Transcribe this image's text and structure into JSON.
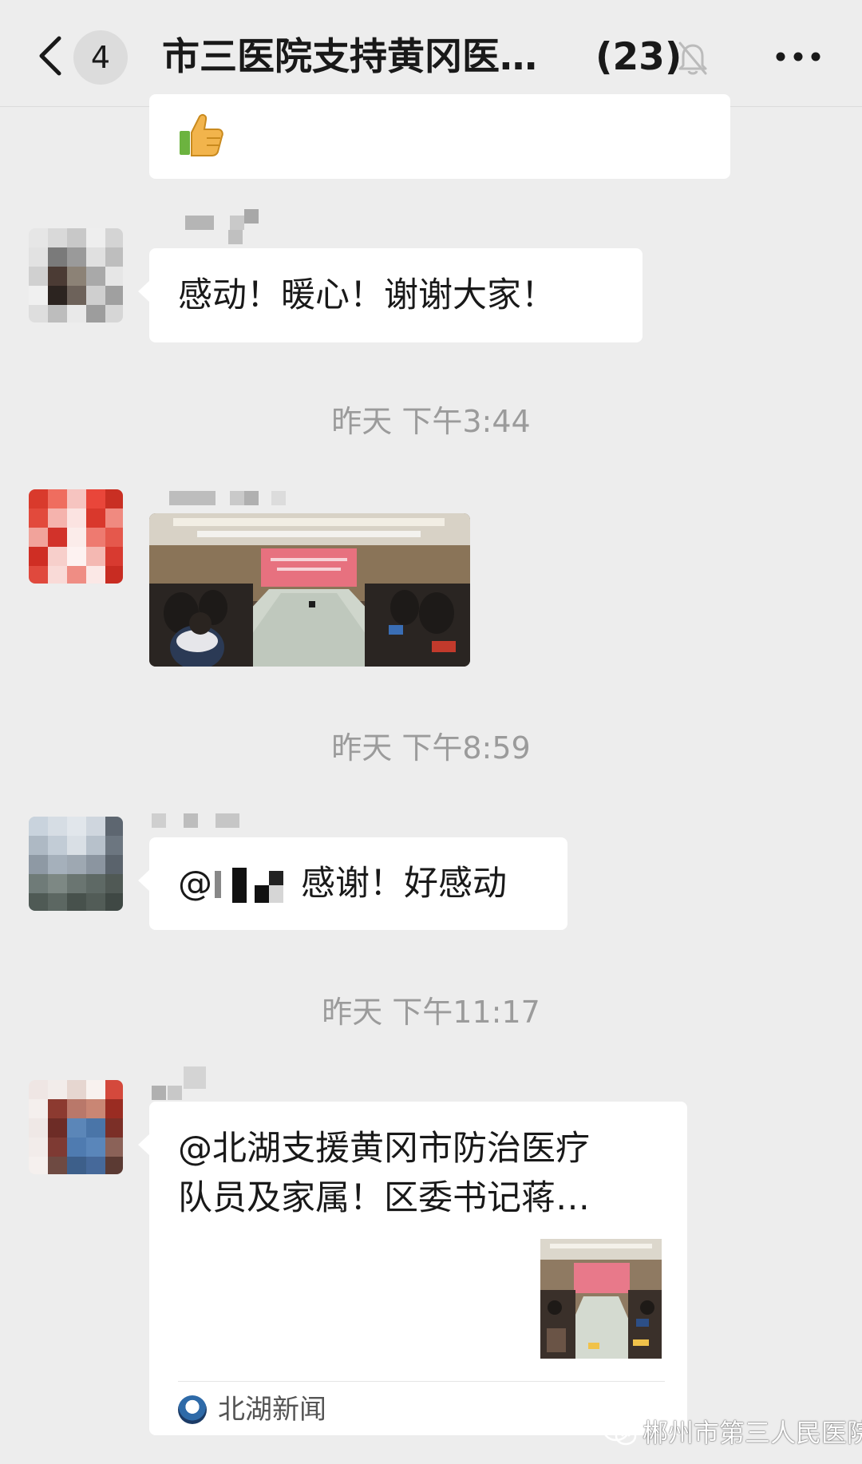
{
  "header": {
    "unread_count": "4",
    "title": "市三医院支持黄冈医…",
    "member_count": "(23)",
    "back_icon": "chevron-left-icon",
    "mute_icon": "bell-muted-icon",
    "more_icon": "ellipsis-icon"
  },
  "messages": [
    {
      "type": "emoji",
      "content": "👍"
    },
    {
      "type": "text",
      "content": "感动！暖心！谢谢大家！"
    },
    {
      "type": "timestamp",
      "content": "昨天 下午3:44"
    },
    {
      "type": "image",
      "content": "conference-room-photo"
    },
    {
      "type": "timestamp",
      "content": "昨天 下午8:59"
    },
    {
      "type": "text",
      "mention": "@",
      "content": "感谢！好感动"
    },
    {
      "type": "timestamp",
      "content": "昨天 下午11:17"
    },
    {
      "type": "link",
      "title_line1": "@北湖支援黄冈市防治医疗",
      "title_line2": "队员及家属！区委书记蒋…",
      "source": "北湖新闻"
    }
  ],
  "watermark": {
    "text": "郴州市第三人民医院",
    "icon": "wechat-icon"
  },
  "colors": {
    "background": "#ededed",
    "bubble": "#ffffff",
    "timestamp": "#9b9b9b"
  }
}
